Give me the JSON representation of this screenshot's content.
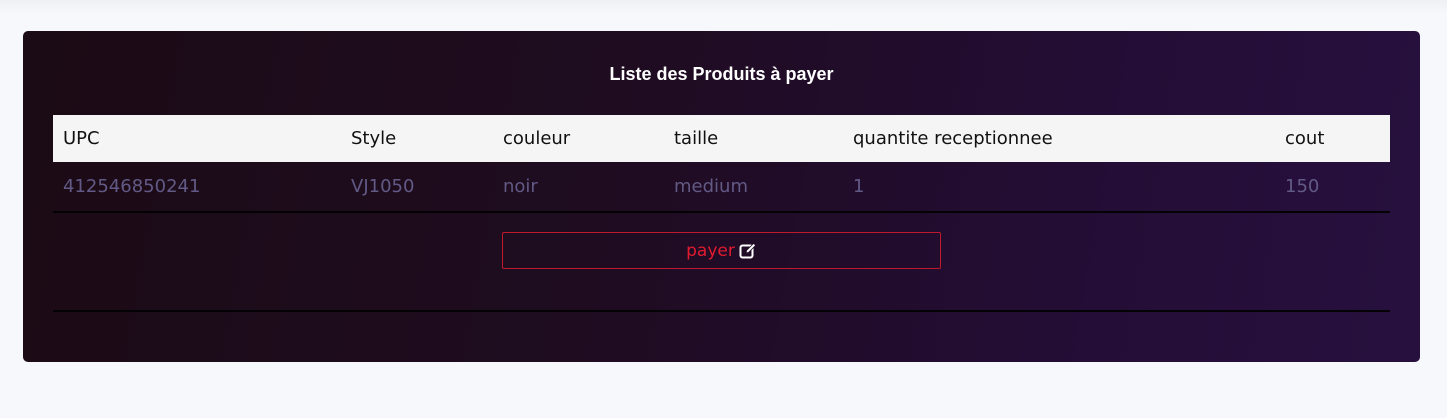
{
  "card": {
    "title": "Liste des Produits à payer"
  },
  "table": {
    "headers": [
      "UPC",
      "Style",
      "couleur",
      "taille",
      "quantite receptionnee",
      "cout"
    ],
    "rows": [
      [
        "412546850241",
        "VJ1050",
        "noir",
        "medium",
        "1",
        "150"
      ]
    ]
  },
  "actions": {
    "pay_label": "payer",
    "pay_icon": "edit-icon"
  },
  "colors": {
    "card_start": "#1b0b14",
    "card_end": "#27103e",
    "button_accent": "#e21a2f",
    "row_text": "#625a86"
  }
}
